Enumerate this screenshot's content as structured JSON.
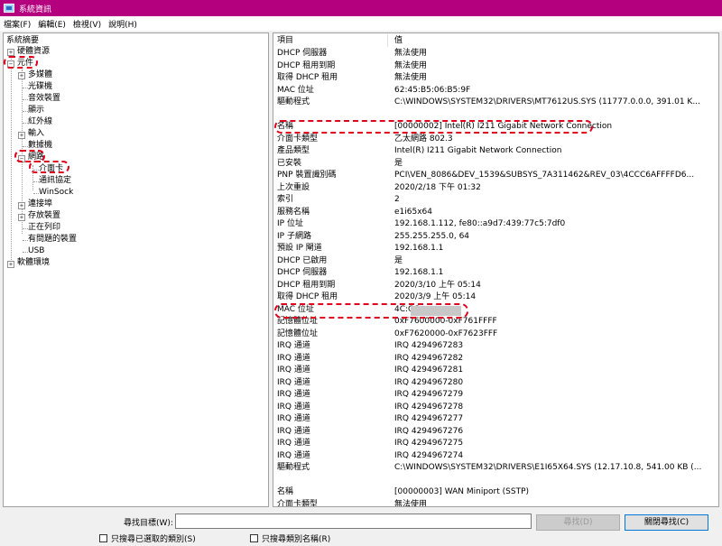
{
  "window": {
    "title": "系統資訊"
  },
  "menu": [
    "檔案(F)",
    "編輯(E)",
    "檢視(V)",
    "說明(H)"
  ],
  "tree": {
    "root": "系統摘要",
    "hardware": "硬體資源",
    "components": "元件",
    "component_children": [
      "多媒體",
      "光碟機",
      "音效裝置",
      "顯示",
      "紅外線",
      "輸入",
      "數據機",
      "網路"
    ],
    "network_children": [
      "介面卡",
      "通訊協定",
      "WinSock"
    ],
    "after_network": [
      "連接埠",
      "存放裝置",
      "正在列印",
      "有問題的裝置",
      "USB"
    ],
    "software": "軟體環境"
  },
  "list": {
    "col_item": "項目",
    "col_value": "值",
    "rows": [
      {
        "item": "DHCP 伺服器",
        "value": "無法使用"
      },
      {
        "item": "DHCP 租用到期",
        "value": "無法使用"
      },
      {
        "item": "取得 DHCP 租用",
        "value": "無法使用"
      },
      {
        "item": "MAC 位址",
        "value": "62:45:B5:06:B5:9F"
      },
      {
        "item": "驅動程式",
        "value": "C:\\WINDOWS\\SYSTEM32\\DRIVERS\\MT7612US.SYS (11777.0.0.0, 391.01 K..."
      },
      {
        "item": "",
        "value": ""
      },
      {
        "item": "名稱",
        "value": "[00000002] Intel(R) I211 Gigabit Network Connection"
      },
      {
        "item": "介面卡類型",
        "value": "乙太網路 802.3"
      },
      {
        "item": "產品類型",
        "value": "Intel(R) I211 Gigabit Network Connection"
      },
      {
        "item": "已安裝",
        "value": "是"
      },
      {
        "item": "PNP 裝置識別碼",
        "value": "PCI\\VEN_8086&DEV_1539&SUBSYS_7A311462&REV_03\\4CCC6AFFFFD6..."
      },
      {
        "item": "上次重設",
        "value": "2020/2/18 下午 01:32"
      },
      {
        "item": "索引",
        "value": "2"
      },
      {
        "item": "服務名稱",
        "value": "e1i65x64"
      },
      {
        "item": "IP 位址",
        "value": "192.168.1.112, fe80::a9d7:439:77c5:7df0"
      },
      {
        "item": "IP 子網路",
        "value": "255.255.255.0, 64"
      },
      {
        "item": "預設 IP 閘道",
        "value": "192.168.1.1"
      },
      {
        "item": "DHCP 已啟用",
        "value": "是"
      },
      {
        "item": "DHCP 伺服器",
        "value": "192.168.1.1"
      },
      {
        "item": "DHCP 租用到期",
        "value": "2020/3/10 上午 05:14"
      },
      {
        "item": "取得 DHCP 租用",
        "value": "2020/3/9 上午 05:14"
      },
      {
        "item": "MAC 位址",
        "value": "4C:CC"
      },
      {
        "item": "記憶體位址",
        "value": "0xF7600000-0xF761FFFF"
      },
      {
        "item": "記憶體位址",
        "value": "0xF7620000-0xF7623FFF"
      },
      {
        "item": "IRQ 通道",
        "value": "IRQ 4294967283"
      },
      {
        "item": "IRQ 通道",
        "value": "IRQ 4294967282"
      },
      {
        "item": "IRQ 通道",
        "value": "IRQ 4294967281"
      },
      {
        "item": "IRQ 通道",
        "value": "IRQ 4294967280"
      },
      {
        "item": "IRQ 通道",
        "value": "IRQ 4294967279"
      },
      {
        "item": "IRQ 通道",
        "value": "IRQ 4294967278"
      },
      {
        "item": "IRQ 通道",
        "value": "IRQ 4294967277"
      },
      {
        "item": "IRQ 通道",
        "value": "IRQ 4294967276"
      },
      {
        "item": "IRQ 通道",
        "value": "IRQ 4294967275"
      },
      {
        "item": "IRQ 通道",
        "value": "IRQ 4294967274"
      },
      {
        "item": "驅動程式",
        "value": "C:\\WINDOWS\\SYSTEM32\\DRIVERS\\E1I65X64.SYS (12.17.10.8, 541.00 KB (..."
      },
      {
        "item": "",
        "value": ""
      },
      {
        "item": "名稱",
        "value": "[00000003] WAN Miniport (SSTP)"
      },
      {
        "item": "介面卡類型",
        "value": "無法使用"
      }
    ]
  },
  "search": {
    "label": "尋找目標(W):",
    "value": "",
    "find_button": "尋找(D)",
    "close_button": "關閉尋找(C)",
    "check_selected": "只搜尋已選取的類別(S)",
    "check_names": "只搜尋類別名稱(R)"
  },
  "colors": {
    "titlebar": "#b4007f",
    "annotation": "#e0001b"
  }
}
